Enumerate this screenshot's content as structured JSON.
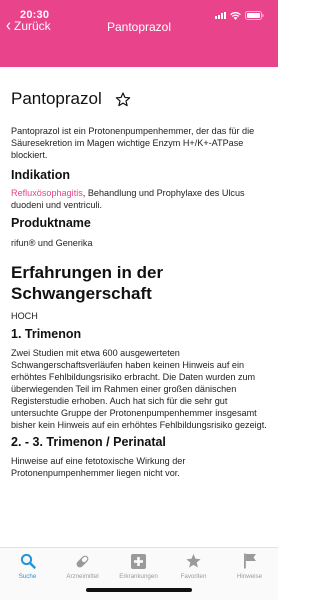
{
  "status_bar": {
    "time": "20:30"
  },
  "nav": {
    "back_label": "Zurück",
    "title": "Pantoprazol"
  },
  "drug": {
    "name": "Pantoprazol",
    "description": "Pantoprazol ist ein Protonenpumpenhemmer, der das für die Säuresekretion im Magen wichtige Enzym H+/K+-ATPase blockiert.",
    "indikation_heading": "Indikation",
    "indikation_link": "Refluxösophagitis",
    "indikation_rest": ", Behandlung und Prophylaxe des Ulcus duodeni und ventriculi.",
    "produkt_heading": "Produktname",
    "produkt_text": "rifun® und Generika"
  },
  "pregnancy": {
    "title": "Erfahrungen in der Schwangerschaft",
    "level": "HOCH",
    "tri1_heading": "1. Trimenon",
    "tri1_text": "Zwei Studien mit etwa 600 ausgewerteten Schwangerschaftsverläufen haben keinen Hinweis auf ein erhöhtes Fehlbildungsrisiko erbracht. Die Daten wurden zum überwiegenden Teil im Rahmen einer großen dänischen Registerstudie erhoben. Auch hat sich für die sehr gut untersuchte Gruppe der Protonenpumpenhemmer insgesamt bisher kein Hinweis auf ein erhöhtes Fehlbildungsrisiko gezeigt.",
    "tri2_heading": "2. - 3. Trimenon / Perinatal",
    "tri2_text": "Hinweise auf eine fetotoxische Wirkung der Protonenpumpenhemmer liegen nicht vor."
  },
  "tabs": [
    {
      "label": "Suche",
      "icon": "search-icon",
      "active": true
    },
    {
      "label": "Arzneimittel",
      "icon": "pill-icon",
      "active": false
    },
    {
      "label": "Erkrankungen",
      "icon": "medical-cross-icon",
      "active": false
    },
    {
      "label": "Favoriten",
      "icon": "star-icon",
      "active": false
    },
    {
      "label": "Hinweise",
      "icon": "flag-icon",
      "active": false
    }
  ],
  "colors": {
    "accent": "#e8438b",
    "tab_active": "#2a93d5",
    "tab_inactive": "#9a9a9a"
  }
}
